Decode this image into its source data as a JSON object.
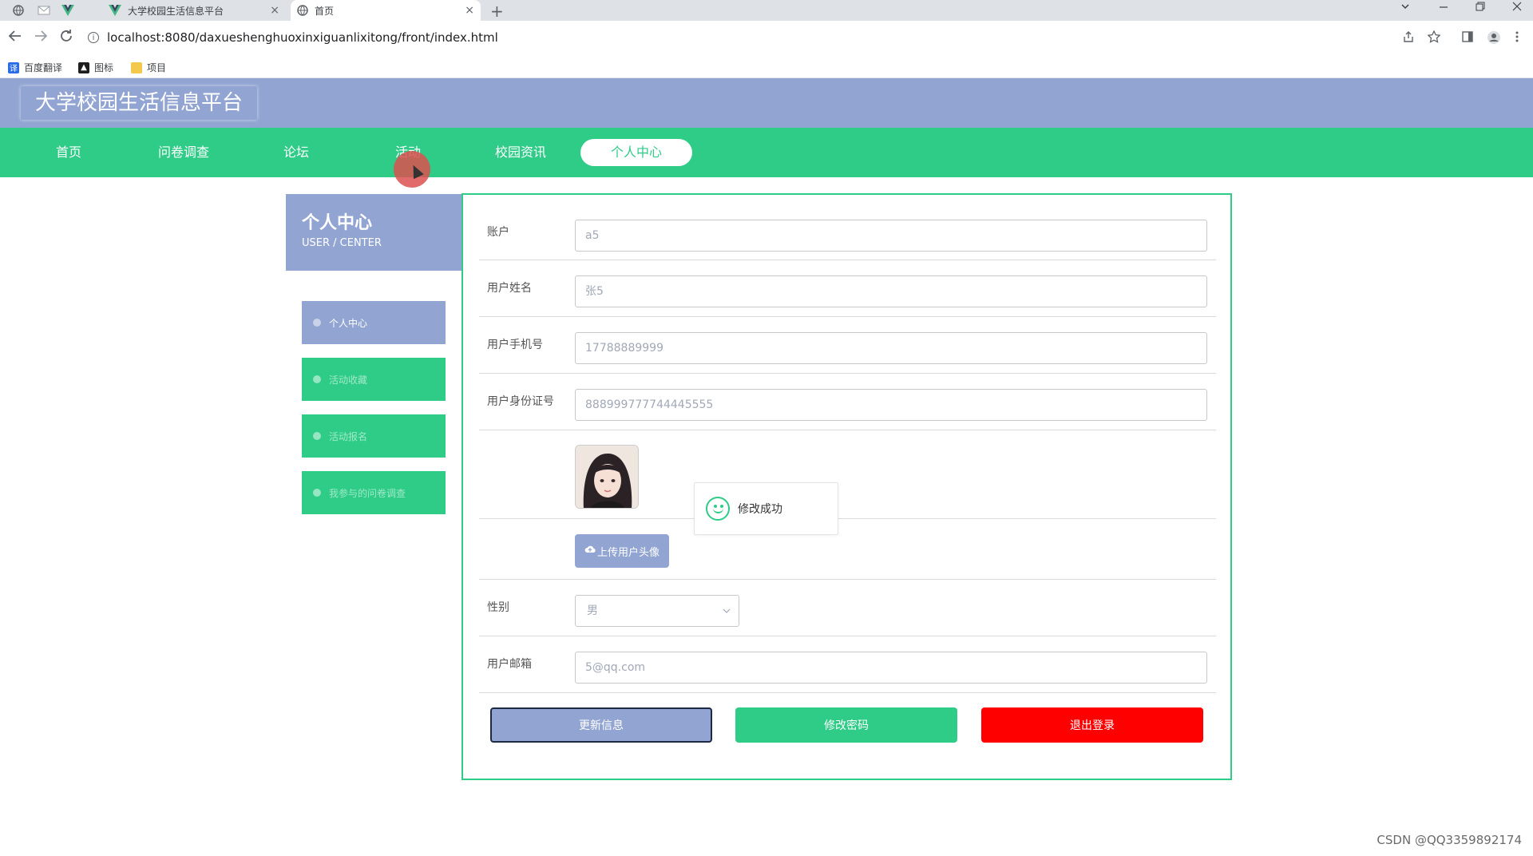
{
  "browser": {
    "tabs": [
      {
        "title": "大学校园生活信息平台"
      },
      {
        "title": "首页"
      }
    ],
    "close_glyph": "×",
    "new_tab": "+",
    "url": "localhost:8080/daxueshenghuoxinxiguanlixitong/front/index.html",
    "bookmarks": [
      {
        "label": "百度翻译",
        "color": "#2a6ce8"
      },
      {
        "label": "图标",
        "color": "#1e1e1e"
      },
      {
        "label": "项目",
        "color": "#f4c84a"
      }
    ]
  },
  "site": {
    "title": "大学校园生活信息平台",
    "nav": [
      "首页",
      "问卷调查",
      "论坛",
      "活动",
      "校园资讯",
      "个人中心"
    ],
    "active_nav": "个人中心"
  },
  "sidebar": {
    "title": "个人中心",
    "subtitle": "USER / CENTER",
    "items": [
      {
        "label": "个人中心"
      },
      {
        "label": "活动收藏"
      },
      {
        "label": "活动报名"
      },
      {
        "label": "我参与的问卷调查"
      }
    ]
  },
  "form": {
    "fields": [
      {
        "label": "账户",
        "value": "a5"
      },
      {
        "label": "用户姓名",
        "value": "张5"
      },
      {
        "label": "用户手机号",
        "value": "17788889999"
      },
      {
        "label": "用户身份证号",
        "value": "888999777744445555"
      }
    ],
    "upload_label": "上传用户头像",
    "gender": {
      "label": "性别",
      "value": "男"
    },
    "email": {
      "label": "用户邮箱",
      "value": "5@qq.com"
    },
    "buttons": {
      "update": "更新信息",
      "password": "修改密码",
      "logout": "退出登录"
    }
  },
  "toast": {
    "message": "修改成功",
    "color": "#2ecc87"
  },
  "watermark": "CSDN @QQ3359892174",
  "colors": {
    "header": "#92a5d2",
    "nav": "#2ecc87",
    "danger": "#ff0000"
  }
}
